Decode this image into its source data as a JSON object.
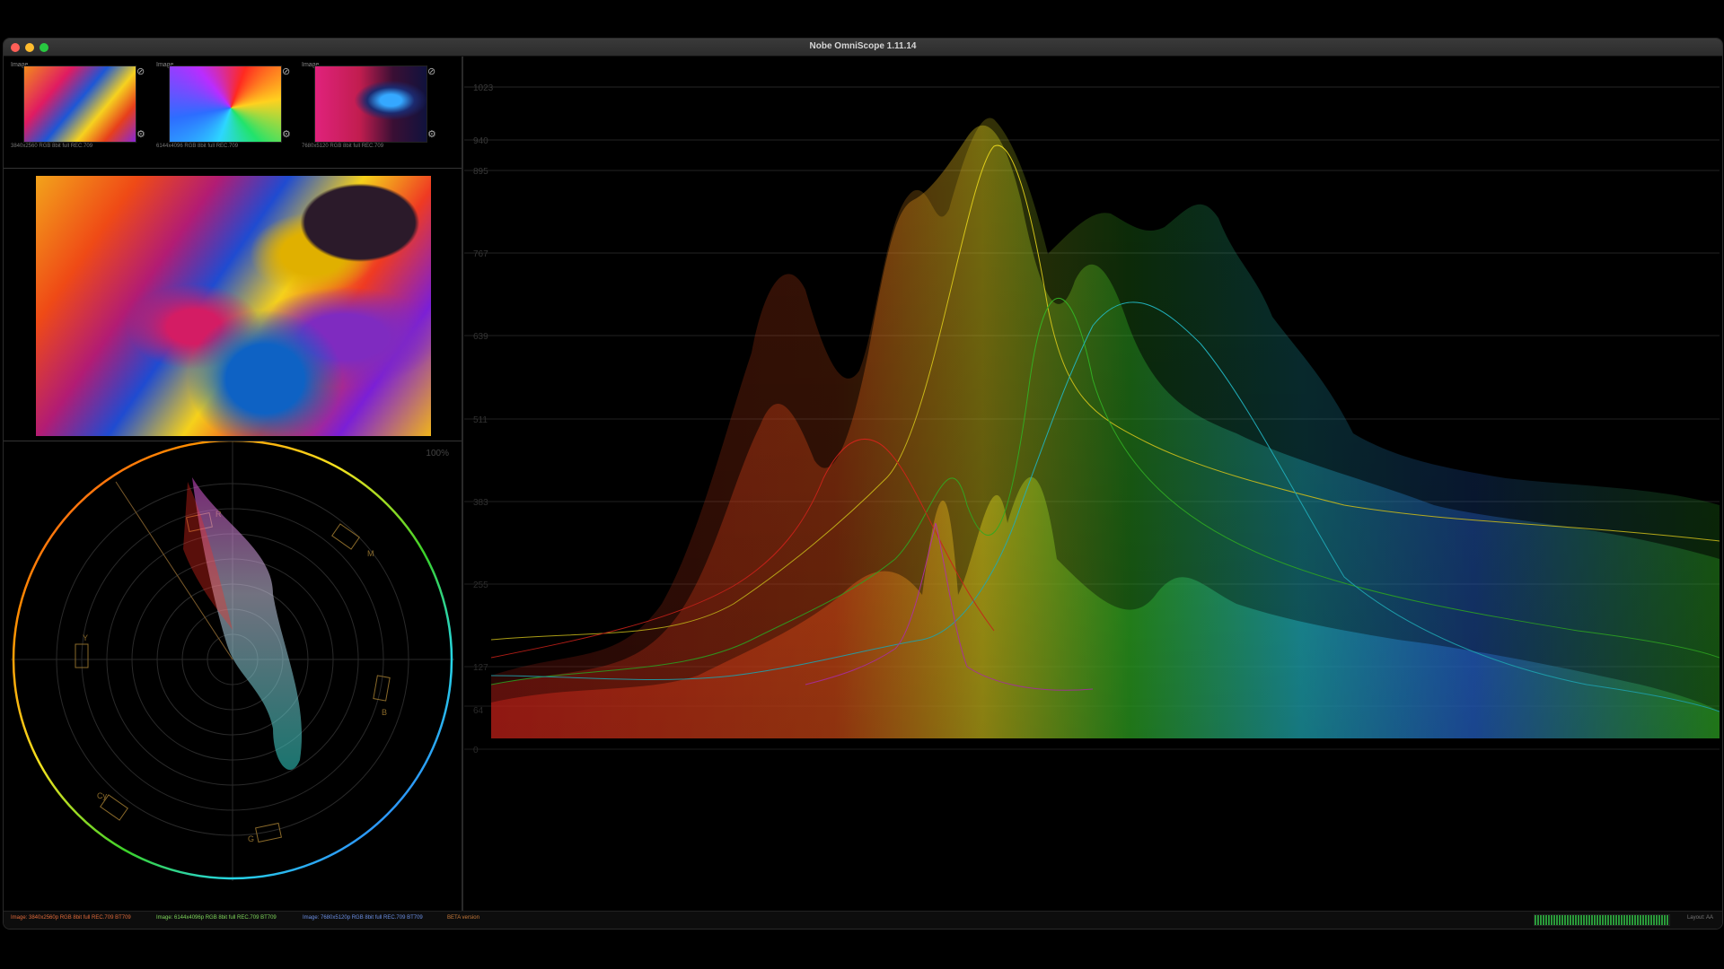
{
  "window": {
    "title": "Nobe OmniScope 1.11.14"
  },
  "thumbnails": [
    {
      "tag": "Image",
      "caption": "3840x2560 RGB 8bit full REC.709",
      "colors": [
        "#f28a1c",
        "#e01b62",
        "#1d57d6",
        "#f6d21f"
      ]
    },
    {
      "tag": "Image",
      "caption": "6144x4096 RGB 8bit full REC.709",
      "colors": [
        "#ff2a20",
        "#ffd11f",
        "#22e36b",
        "#2d6dff"
      ]
    },
    {
      "tag": "Image",
      "caption": "7680x5120 RGB 8bit full REC.709",
      "colors": [
        "#10123d",
        "#e0227c",
        "#35a8ff",
        "#c11d4f"
      ]
    }
  ],
  "vectorscope": {
    "percent_label": "100%",
    "targets": [
      "R",
      "M",
      "B",
      "Cy",
      "G",
      "Y"
    ]
  },
  "waveform": {
    "scale": [
      "1023",
      "940",
      "895",
      "767",
      "639",
      "511",
      "383",
      "255",
      "127",
      "64",
      "0"
    ]
  },
  "statusbar": {
    "image1": "Image: 3840x2560p RGB 8bit full REC.709 BT709",
    "image2": "Image: 6144x4096p RGB 8bit full REC.709 BT709",
    "image3": "Image: 7680x5120p RGB 8bit full REC.709 BT709",
    "beta": "BETA version",
    "layout": "Layout: AA"
  },
  "colors": {
    "red": "#ff2a20",
    "yellow": "#f5e21f",
    "green": "#39d12a",
    "cyan": "#27d6e6",
    "blue": "#2f7cff",
    "magenta": "#e03bd7"
  }
}
